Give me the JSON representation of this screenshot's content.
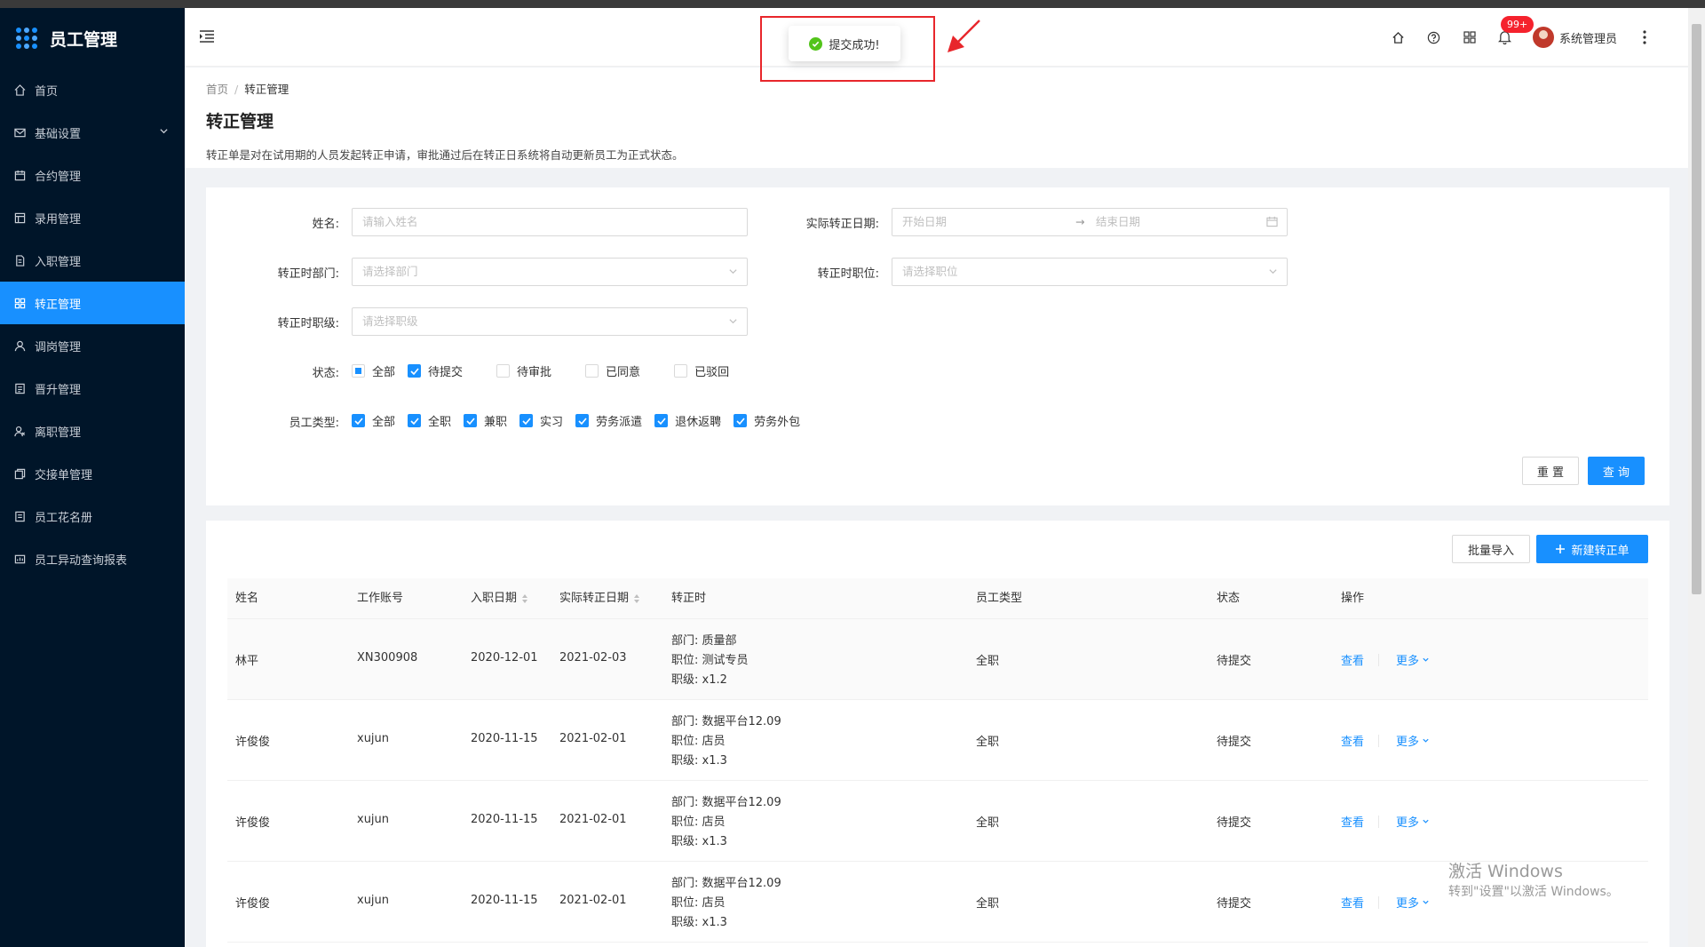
{
  "app": {
    "title": "员工管理"
  },
  "sidebar": {
    "items": [
      {
        "label": "首页",
        "icon": "home-icon"
      },
      {
        "label": "基础设置",
        "icon": "mail-icon",
        "expandable": true
      },
      {
        "label": "合约管理",
        "icon": "calendar-icon"
      },
      {
        "label": "录用管理",
        "icon": "table-icon"
      },
      {
        "label": "入职管理",
        "icon": "file-icon"
      },
      {
        "label": "转正管理",
        "icon": "grid-icon",
        "active": true
      },
      {
        "label": "调岗管理",
        "icon": "user-icon"
      },
      {
        "label": "晋升管理",
        "icon": "doc-icon"
      },
      {
        "label": "离职管理",
        "icon": "user-leave-icon"
      },
      {
        "label": "交接单管理",
        "icon": "copy-icon"
      },
      {
        "label": "员工花名册",
        "icon": "book-icon"
      },
      {
        "label": "员工异动查询报表",
        "icon": "report-icon"
      }
    ]
  },
  "header": {
    "notification_count": "99+",
    "user_name": "系统管理员",
    "icons": [
      "home-icon",
      "help-icon",
      "apps-icon",
      "bell-icon",
      "more-vertical-icon"
    ]
  },
  "toast": {
    "message": "提交成功!",
    "type": "success"
  },
  "page": {
    "breadcrumb": {
      "home": "首页",
      "current": "转正管理"
    },
    "title": "转正管理",
    "description": "转正单是对在试用期的人员发起转正申请，审批通过后在转正日系统将自动更新员工为正式状态。"
  },
  "filters": {
    "name": {
      "label": "姓名:",
      "placeholder": "请输入姓名"
    },
    "date": {
      "label": "实际转正日期:",
      "start_placeholder": "开始日期",
      "end_placeholder": "结束日期"
    },
    "department": {
      "label": "转正时部门:",
      "placeholder": "请选择部门"
    },
    "position": {
      "label": "转正时职位:",
      "placeholder": "请选择职位"
    },
    "level": {
      "label": "转正时职级:",
      "placeholder": "请选择职级"
    },
    "status": {
      "label": "状态:",
      "options": [
        {
          "label": "全部",
          "state": "indeterminate"
        },
        {
          "label": "待提交",
          "state": "checked"
        },
        {
          "label": "待审批",
          "state": "unchecked"
        },
        {
          "label": "已同意",
          "state": "unchecked"
        },
        {
          "label": "已驳回",
          "state": "unchecked"
        }
      ]
    },
    "emp_type": {
      "label": "员工类型:",
      "options": [
        {
          "label": "全部",
          "state": "checked"
        },
        {
          "label": "全职",
          "state": "checked"
        },
        {
          "label": "兼职",
          "state": "checked"
        },
        {
          "label": "实习",
          "state": "checked"
        },
        {
          "label": "劳务派遣",
          "state": "checked"
        },
        {
          "label": "退休返聘",
          "state": "checked"
        },
        {
          "label": "劳务外包",
          "state": "checked"
        }
      ]
    },
    "reset_label": "重 置",
    "search_label": "查 询"
  },
  "table": {
    "import_label": "批量导入",
    "new_label": "新建转正单",
    "columns": [
      "姓名",
      "工作账号",
      "入职日期",
      "实际转正日期",
      "转正时",
      "员工类型",
      "状态",
      "操作"
    ],
    "rows": [
      {
        "name": "林平",
        "account": "XN300908",
        "join": "2020-12-01",
        "regular": "2021-02-03",
        "dept": "部门: 质量部",
        "pos": "职位: 测试专员",
        "lvl": "职级: x1.2",
        "type": "全职",
        "status": "待提交",
        "view": "查看",
        "more": "更多"
      },
      {
        "name": "许俊俊",
        "account": "xujun",
        "join": "2020-11-15",
        "regular": "2021-02-01",
        "dept": "部门: 数据平台12.09",
        "pos": "职位: 店员",
        "lvl": "职级: x1.3",
        "type": "全职",
        "status": "待提交",
        "view": "查看",
        "more": "更多"
      },
      {
        "name": "许俊俊",
        "account": "xujun",
        "join": "2020-11-15",
        "regular": "2021-02-01",
        "dept": "部门: 数据平台12.09",
        "pos": "职位: 店员",
        "lvl": "职级: x1.3",
        "type": "全职",
        "status": "待提交",
        "view": "查看",
        "more": "更多"
      },
      {
        "name": "许俊俊",
        "account": "xujun",
        "join": "2020-11-15",
        "regular": "2021-02-01",
        "dept": "部门: 数据平台12.09",
        "pos": "职位: 店员",
        "lvl": "职级: x1.3",
        "type": "全职",
        "status": "待提交",
        "view": "查看",
        "more": "更多"
      }
    ]
  },
  "watermark": {
    "line1": "激活 Windows",
    "line2": "转到\"设置\"以激活 Windows。"
  },
  "colors": {
    "primary": "#1890ff",
    "sidebar": "#001529",
    "success": "#52c41a",
    "badge": "#f5222d",
    "annotation": "#e8262b"
  }
}
